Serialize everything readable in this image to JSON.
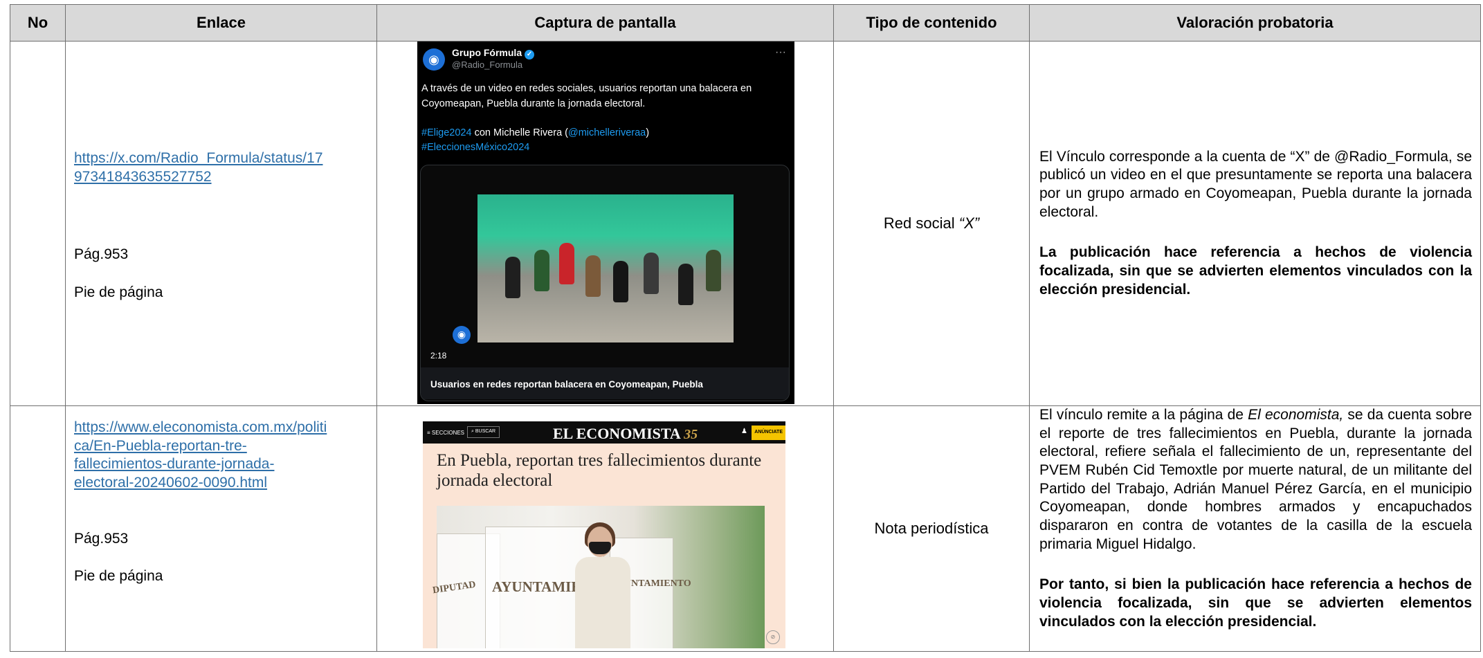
{
  "headers": {
    "no": "No",
    "link": "Enlace",
    "capture": "Captura de pantalla",
    "type": "Tipo de contenido",
    "valuation": "Valoración probatoria"
  },
  "rows": [
    {
      "no": "",
      "link": "https://x.com/Radio_Formula/status/1797341843635527752",
      "link_line1": "https://x.com/Radio_Formula/status/17",
      "link_line2": "97341843635527752",
      "page": "Pág.953",
      "note": "Pie de página",
      "type": "Red social",
      "type_em": "“X”",
      "valuation_text": "El Vínculo corresponde a la cuenta de “X” de @Radio_Formula, se publicó un video en el que presuntamente se reporta una balacera por un grupo armado en Coyomeapan, Puebla durante la jornada electoral.",
      "valuation_bold": "La publicación hace referencia a hechos de violencia focalizada, sin que se advierten elementos vinculados con la elección presidencial.",
      "capture": {
        "account_name": "Grupo Fórmula",
        "account_handle": "@Radio_Formula",
        "more": "···",
        "text": "A través de un video en redes sociales, usuarios reportan una balacera en Coyomeapan, Puebla durante la jornada electoral.",
        "tag1": "#Elige2024",
        "with": " con Michelle Rivera (",
        "mention": "@michelleriveraa",
        "close": ")",
        "tag2": "#EleccionesMéxico2024",
        "duration": "2:18",
        "video_caption": "Usuarios en redes reportan balacera en Coyomeapan, Puebla"
      }
    },
    {
      "no": "",
      "link": "https://www.eleconomista.com.mx/politica/En-Puebla-reportan-tres-fallecimientos-durante-jornada-electoral-20240602-0090.html",
      "link_line1": "https://www.eleconomista.com.mx/politi",
      "link_line2": "ca/En-Puebla-reportan-tre-",
      "link_line3": "fallecimientos-durante-jornada-",
      "link_line4": "electoral-20240602-0090.html",
      "page": "Pág.953",
      "note": "Pie de página",
      "type": "Nota periodística",
      "valuation_pre": "El vínculo remite a la página de ",
      "valuation_em": "El economista,",
      "valuation_text": " se da cuenta sobre el reporte de tres fallecimientos en Puebla, durante la jornada electoral, refiere señala el fallecimiento de un, representante del PVEM Rubén Cid Temoxtle por muerte natural, de un militante del Partido del Trabajo, Adrián Manuel Pérez García, en el municipio Coyomeapan, donde hombres armados y encapuchados dispararon en contra de votantes de la casilla de la escuela primaria Miguel Hidalgo.",
      "valuation_bold": "Por tanto, si bien la publicación hace referencia a hechos de violencia focalizada, sin que se advierten elementos vinculados con la elección presidencial.",
      "capture": {
        "sections": "≡ SECCIONES",
        "search": "⌕ BUSCAR",
        "logo": "EL ECONOMISTA",
        "anniversary": "35",
        "subscribe": "ANÚNCIATE",
        "headline": "En Puebla, reportan tres fallecimientos durante jornada electoral",
        "ballot_word1": "DIPUTAD",
        "ballot_word2": "AYUNTAMIENTO",
        "ballot_word3": "AYUNTAMIENTO"
      }
    }
  ]
}
